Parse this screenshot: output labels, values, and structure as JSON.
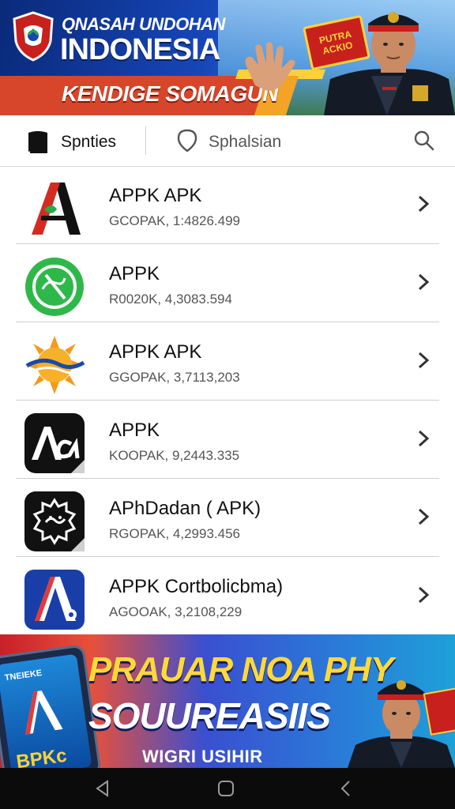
{
  "top_banner": {
    "title_line1": "QNASAH UNDOHAN",
    "title_line2": "INDONESIA",
    "subtitle": "KENDIGE SOMAGUN",
    "badge_text_1": "PUTRA",
    "badge_text_2": "ACKIO",
    "shield_icon": "shield-logo-icon"
  },
  "filter_bar": {
    "tab1_label": "Spnties",
    "tab1_icon": "book-icon",
    "tab2_label": "Sphalsian",
    "tab2_icon": "location-pin-icon",
    "search_icon": "search-icon"
  },
  "apps": [
    {
      "title": "APPK APK",
      "subtitle": "GCOPAK, 1:4826.499",
      "icon": "letter-a-red-icon"
    },
    {
      "title": "APPK",
      "subtitle": "R0020K, 4,3083.594",
      "icon": "green-circle-app-icon"
    },
    {
      "title": "APPK APK",
      "subtitle": "GGOPAK, 3,7113,203",
      "icon": "sun-wave-icon"
    },
    {
      "title": "APPK",
      "subtitle": "KOOPAK, 9,2443.335",
      "icon": "alpha-black-icon"
    },
    {
      "title": "APhDadan ( APK)",
      "subtitle": "RGOPAK, 4,2993.456",
      "icon": "gear-face-icon"
    },
    {
      "title": "APPK Cortbolicbma)",
      "subtitle": "AGOOAK, 3,2108,229",
      "icon": "letter-a-blue-icon"
    }
  ],
  "bottom_banner": {
    "line1": "PRAUAR NOA PHY",
    "line2": "SOUUREASIIS",
    "line3": "WIGRI USIHIR",
    "phone_header": "TNEIEKE",
    "phone_brand": "BPKc"
  },
  "nav_bar": {
    "back_icon": "back-triangle-icon",
    "home_icon": "home-square-icon",
    "recent_icon": "back-chevron-icon"
  },
  "colors": {
    "banner_blue": "#1646b8",
    "banner_red": "#d7452a",
    "banner_yellow": "#ffd93a",
    "divider": "#d0d0d0",
    "nav_bg": "#0b0b0b"
  }
}
